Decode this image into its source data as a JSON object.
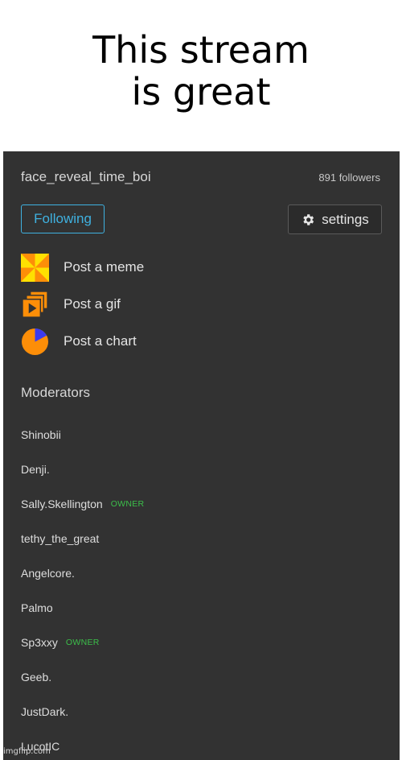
{
  "caption": {
    "line1": "This stream",
    "line2": "is great"
  },
  "stream": {
    "name": "face_reveal_time_boi",
    "followers": "891 followers"
  },
  "buttons": {
    "following": "Following",
    "settings": "settings"
  },
  "actions": [
    {
      "label": "Post a meme",
      "icon": "meme-icon"
    },
    {
      "label": "Post a gif",
      "icon": "gif-icon"
    },
    {
      "label": "Post a chart",
      "icon": "chart-icon"
    }
  ],
  "moderators": {
    "heading": "Moderators",
    "list": [
      {
        "name": "Shinobii",
        "badge": ""
      },
      {
        "name": "Denji.",
        "badge": ""
      },
      {
        "name": "Sally.Skellington",
        "badge": "OWNER"
      },
      {
        "name": "tethy_the_great",
        "badge": ""
      },
      {
        "name": "Angelcore.",
        "badge": ""
      },
      {
        "name": "Palmo",
        "badge": ""
      },
      {
        "name": "Sp3xxy",
        "badge": "OWNER"
      },
      {
        "name": "Geeb.",
        "badge": ""
      },
      {
        "name": "JustDark.",
        "badge": ""
      },
      {
        "name": "LucotIC",
        "badge": ""
      }
    ]
  },
  "watermark": "imgflip.com",
  "colors": {
    "panel_bg": "#323232",
    "accent_blue": "#3fb1e0",
    "owner_green": "#3cbf4a",
    "icon_orange": "#fd8e08",
    "icon_yellow": "#fee001",
    "chart_slice": "#3b3bf0"
  }
}
